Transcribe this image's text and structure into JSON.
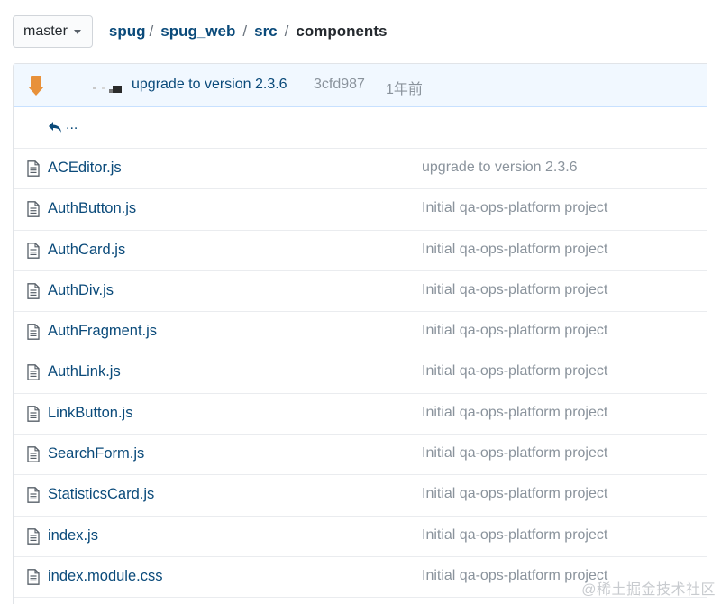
{
  "branch": {
    "label": "master"
  },
  "breadcrumb": {
    "items": [
      "spug",
      "spug_web",
      "src"
    ],
    "separator": "/",
    "current": "components"
  },
  "latest_commit": {
    "message": "upgrade to version 2.3.6",
    "sha": "3cfd987",
    "age": "1年前"
  },
  "up_dir": {
    "label": "..."
  },
  "files": [
    {
      "name": "ACEditor.js",
      "message": "upgrade to version 2.3.6"
    },
    {
      "name": "AuthButton.js",
      "message": "Initial qa-ops-platform project"
    },
    {
      "name": "AuthCard.js",
      "message": "Initial qa-ops-platform project"
    },
    {
      "name": "AuthDiv.js",
      "message": "Initial qa-ops-platform project"
    },
    {
      "name": "AuthFragment.js",
      "message": "Initial qa-ops-platform project"
    },
    {
      "name": "AuthLink.js",
      "message": "Initial qa-ops-platform project"
    },
    {
      "name": "LinkButton.js",
      "message": "Initial qa-ops-platform project"
    },
    {
      "name": "SearchForm.js",
      "message": "Initial qa-ops-platform project"
    },
    {
      "name": "StatisticsCard.js",
      "message": "Initial qa-ops-platform project"
    },
    {
      "name": "index.js",
      "message": "Initial qa-ops-platform project"
    },
    {
      "name": "index.module.css",
      "message": "Initial qa-ops-platform project"
    }
  ],
  "watermark": "@稀土掘金技术社区",
  "colors": {
    "link": "#0a4a7a",
    "muted": "#8a939c",
    "commit_bar": "#f1f8ff",
    "avatar": "#e8913a"
  }
}
